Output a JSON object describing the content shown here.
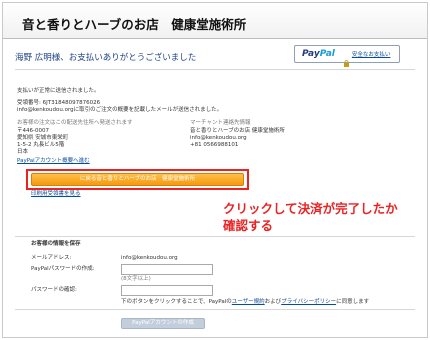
{
  "header": {
    "shop_title": "音と香りとハーブのお店　健康堂施術所"
  },
  "thanks": "海野 広明様、お支払いありがとうございました",
  "paypal": {
    "logo_pay": "Pay",
    "logo_pal": "Pal",
    "safety_link": "安全なお支払い"
  },
  "confirmation": {
    "sent_notice": "支払いが正常に送信されました。",
    "receipt_id": "受領番号: 6JT31848097876026",
    "email_notice": "info@kenkoudou.orgに取引のご注文の概要を記載したメールが送信されました。"
  },
  "shipping": {
    "heading": "お客様の注文はこの配送先住所へ発送されます",
    "postal": "〒446-0007",
    "address1": "愛知県 安城市東栄町",
    "address2": "1-5-2 丸長ビル5階",
    "country": "日本",
    "account_link": "PayPalアカウント概要へ進む"
  },
  "merchant": {
    "heading": "マーチャント連絡先情報",
    "name": "音と香りとハーブのお店 健康堂施術所",
    "email": "info@kenkoudou.org",
    "phone": "+81 0566988101"
  },
  "return_button": "に戻る音と香りとハーブのお店　健康堂施術所",
  "print_link": "印刷用受領書を見る",
  "annotation": {
    "line1": "クリックして決済が完了したか",
    "line2": "確認する"
  },
  "save_info": {
    "heading": "お客様の情報を保存",
    "email_label": "メールアドレス:",
    "email_value": "info@kenkoudou.org",
    "password_create_label": "PayPalパスワードの作成:",
    "password_hint": "(8文字以上)",
    "password_confirm_label": "パスワードの確認:",
    "agree_prefix": "下のボタンをクリックすることで、PayPalの",
    "user_agreement": "ユーザー規約",
    "agree_middle": "および",
    "privacy_policy": "プライバシーポリシー",
    "agree_suffix": "に同意します",
    "create_button": "PayPalアカウントの作成"
  }
}
